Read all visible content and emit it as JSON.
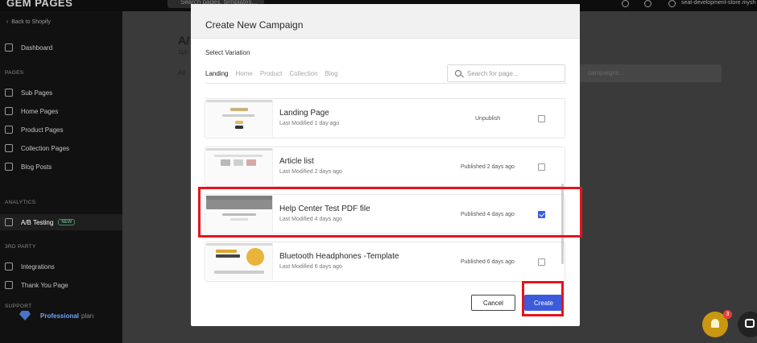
{
  "topbar": {
    "logo": "GEM PAGES",
    "search_placeholder": "Search pages, templates...",
    "store_name": "seat-development-store.mysh"
  },
  "sidebar": {
    "back_label": "Back to Shopify",
    "dashboard": "Dashboard",
    "pages_section": "PAGES",
    "items": [
      {
        "label": "Sub Pages",
        "icon": "file-icon"
      },
      {
        "label": "Home Pages",
        "icon": "home-icon"
      },
      {
        "label": "Product Pages",
        "icon": "tag-icon"
      },
      {
        "label": "Collection Pages",
        "icon": "grid-icon"
      },
      {
        "label": "Blog Posts",
        "icon": "pencil-icon"
      }
    ],
    "analytics_section": "ANALYTICS",
    "ab_testing": "A/B Testing",
    "ab_badge": "NEW",
    "third_party_section": "3RD PARTY",
    "integrations": "Integrations",
    "thank_you": "Thank You Page",
    "support_section": "SUPPORT",
    "plan_name": "Professional",
    "plan_suffix": "plan"
  },
  "main": {
    "title": "A/",
    "subtitle": "Spli",
    "tab_all": "All",
    "search_placeholder": "campaigns..."
  },
  "modal": {
    "title": "Create New Campaign",
    "select_label": "Select Variation",
    "tabs": [
      "Landing",
      "Home",
      "Product",
      "Collection",
      "Blog"
    ],
    "search_placeholder": "Search for page...",
    "rows": [
      {
        "title": "Landing Page",
        "modified": "Last Modified 1 day ago",
        "status": "Unpublish",
        "checked": false
      },
      {
        "title": "Article list",
        "modified": "Last Modified 2 days ago",
        "status": "Published 2 days ago",
        "checked": false
      },
      {
        "title": "Help Center Test PDF file",
        "modified": "Last Modified 4 days ago",
        "status": "Published 4 days ago",
        "checked": true
      },
      {
        "title": "Bluetooth Headphones -Template",
        "modified": "Last Modified 6 days ago",
        "status": "Published 6 days ago",
        "checked": false
      }
    ],
    "cancel_label": "Cancel",
    "create_label": "Create"
  },
  "notifications": {
    "count": "3"
  },
  "colors": {
    "accent": "#3b5bdb",
    "highlight": "#e8131c"
  }
}
